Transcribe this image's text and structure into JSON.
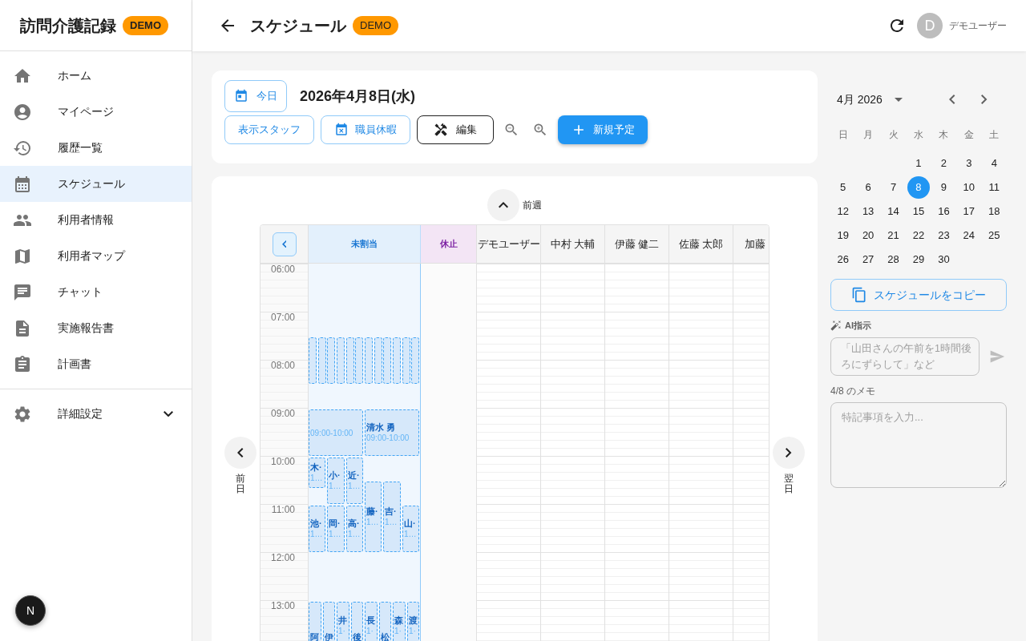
{
  "sidebar": {
    "title": "訪問介護記録",
    "badge": "DEMO",
    "items": [
      {
        "label": "ホーム",
        "selected": false
      },
      {
        "label": "マイページ",
        "selected": false
      },
      {
        "label": "履歴一覧",
        "selected": false
      },
      {
        "label": "スケジュール",
        "selected": true
      },
      {
        "label": "利用者情報",
        "selected": false
      },
      {
        "label": "利用者マップ",
        "selected": false
      },
      {
        "label": "チャット",
        "selected": false
      },
      {
        "label": "実施報告書",
        "selected": false
      },
      {
        "label": "計画書",
        "selected": false
      }
    ],
    "settings": {
      "label": "詳細設定",
      "expanded": false
    }
  },
  "dev_badge": "N",
  "header": {
    "title": "スケジュール",
    "badge": "DEMO",
    "user_initial": "D",
    "user_name": "デモユーザー"
  },
  "toolbar": {
    "today_button": "今日",
    "date": "2026年4月8日(水)",
    "staff_button": "表示スタッフ",
    "leave_button": "職員休暇",
    "edit_button": "編集",
    "new_button": "新規予定"
  },
  "schedule": {
    "prev_week": "前週",
    "prev_day": "前日",
    "next_day": "翌日",
    "hours": [
      "06:00",
      "07:00",
      "08:00",
      "09:00",
      "10:00",
      "11:00",
      "12:00",
      "13:00"
    ],
    "columns": [
      {
        "kind": "unassigned",
        "label": "未割当",
        "events": [
          {
            "kind": "collapsed"
          },
          {
            "kind": "collapsed"
          },
          {
            "kind": "collapsed"
          },
          {
            "kind": "collapsed"
          },
          {
            "kind": "collapsed"
          },
          {
            "kind": "collapsed"
          },
          {
            "kind": "collapsed"
          },
          {
            "kind": "collapsed"
          },
          {
            "kind": "collapsed"
          },
          {
            "kind": "collapsed"
          },
          {
            "kind": "collapsed"
          },
          {
            "kind": "collapsed"
          },
          {
            "kind": "card",
            "time": "09:00-10:00"
          },
          {
            "kind": "card",
            "name": "清水 勇",
            "time": "09:00-10:00"
          },
          {
            "kind": "card",
            "name": "木·",
            "time": "1…"
          },
          {
            "kind": "card",
            "name": "小·",
            "time": "1…"
          },
          {
            "kind": "card",
            "name": "近·",
            "time": "1…"
          },
          {
            "kind": "card",
            "name": "藤·",
            "time": "1…"
          },
          {
            "kind": "card",
            "name": "吉·",
            "time": "1…"
          },
          {
            "kind": "card",
            "name": "池·",
            "time": "1…"
          },
          {
            "kind": "card",
            "name": "岡·",
            "time": "1…"
          },
          {
            "kind": "card",
            "name": "高·",
            "time": "1…"
          },
          {
            "kind": "card",
            "name": "山·",
            "time": "1…"
          },
          {
            "kind": "card",
            "name": "阿"
          },
          {
            "kind": "card",
            "name": "伊"
          },
          {
            "kind": "card",
            "name": "井",
            "time": "1·"
          },
          {
            "kind": "card",
            "name": "後"
          },
          {
            "kind": "card",
            "name": "長",
            "time": "1·"
          },
          {
            "kind": "card",
            "name": "松"
          },
          {
            "kind": "card",
            "name": "森",
            "time": "1·"
          },
          {
            "kind": "card",
            "name": "渡",
            "time": "1·"
          }
        ]
      },
      {
        "kind": "paused",
        "label": "休止"
      },
      {
        "kind": "staff",
        "label": "デモユーザー"
      },
      {
        "kind": "staff",
        "label": "中村 大輔"
      },
      {
        "kind": "staff",
        "label": "伊藤 健二"
      },
      {
        "kind": "staff",
        "label": "佐藤 太郎"
      },
      {
        "kind": "partial",
        "label": "加藤"
      }
    ]
  },
  "calendar": {
    "month": "4月 2026",
    "weekdays": [
      "日",
      "月",
      "火",
      "水",
      "木",
      "金",
      "土"
    ],
    "weeks": [
      {
        "days": [
          {
            "label": "1",
            "selected": false
          },
          {
            "label": "2",
            "selected": false
          },
          {
            "label": "3",
            "selected": false
          },
          {
            "label": "4",
            "selected": false
          }
        ]
      },
      {
        "days": [
          {
            "label": "5",
            "selected": false
          },
          {
            "label": "6",
            "selected": false
          },
          {
            "label": "7",
            "selected": false
          },
          {
            "label": "8",
            "selected": true
          },
          {
            "label": "9",
            "selected": false
          },
          {
            "label": "10",
            "selected": false
          },
          {
            "label": "11",
            "selected": false
          }
        ]
      },
      {
        "days": [
          {
            "label": "12",
            "selected": false
          },
          {
            "label": "13",
            "selected": false
          },
          {
            "label": "14",
            "selected": false
          },
          {
            "label": "15",
            "selected": false
          },
          {
            "label": "16",
            "selected": false
          },
          {
            "label": "17",
            "selected": false
          },
          {
            "label": "18",
            "selected": false
          }
        ]
      },
      {
        "days": [
          {
            "label": "19",
            "selected": false
          },
          {
            "label": "20",
            "selected": false
          },
          {
            "label": "21",
            "selected": false
          },
          {
            "label": "22",
            "selected": false
          },
          {
            "label": "23",
            "selected": false
          },
          {
            "label": "24",
            "selected": false
          },
          {
            "label": "25",
            "selected": false
          }
        ]
      },
      {
        "days": [
          {
            "label": "26",
            "selected": false
          },
          {
            "label": "27",
            "selected": false
          },
          {
            "label": "28",
            "selected": false
          },
          {
            "label": "29",
            "selected": false
          },
          {
            "label": "30",
            "selected": false
          }
        ]
      }
    ],
    "copy_button": "スケジュールをコピー",
    "ai_label": "AI指示",
    "ai_placeholder": "「山田さんの午前を1時間後ろにずらして」など",
    "memo_label": "4/8 のメモ",
    "memo_placeholder": "特記事項を入力..."
  }
}
